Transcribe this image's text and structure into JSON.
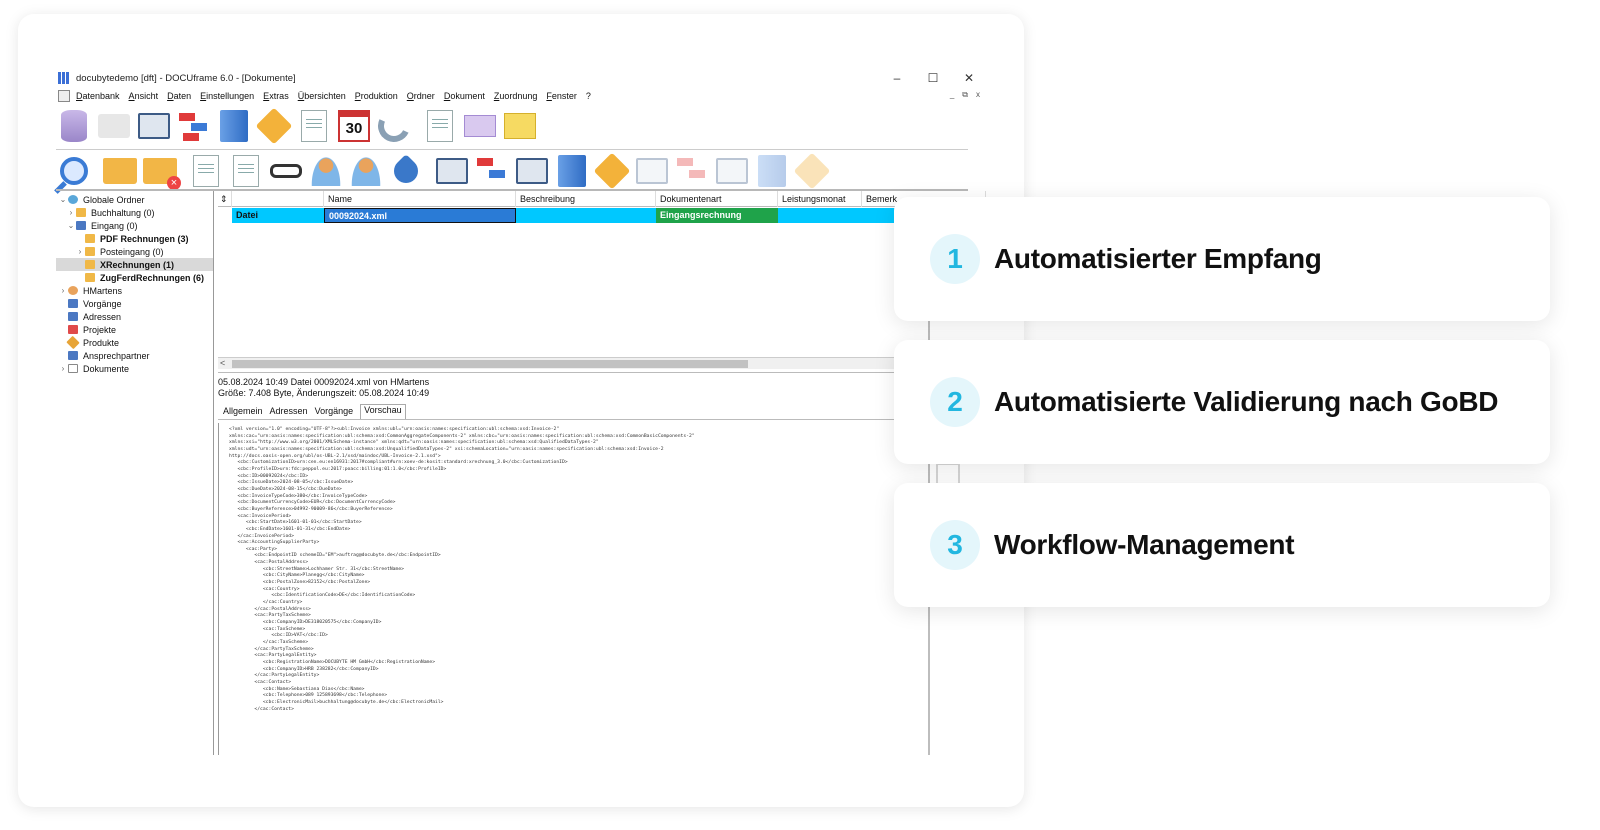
{
  "window": {
    "title": "docubytedemo [dft] - DOCUframe 6.0 - [Dokumente]",
    "controls": [
      "–",
      "☐",
      "✕"
    ],
    "mdi_controls": [
      "_",
      "⧉",
      "x"
    ]
  },
  "menu": [
    "Datenbank",
    "Ansicht",
    "Daten",
    "Einstellungen",
    "Extras",
    "Übersichten",
    "Produktion",
    "Ordner",
    "Dokument",
    "Zuordnung",
    "Fenster",
    "?"
  ],
  "toolbar_icons_row1": [
    "database-icon",
    "printer-icon",
    "contact-card-icon",
    "workflow-icon",
    "book-icon",
    "tag-icon",
    "document-icon",
    "calendar-icon",
    "phone-icon",
    "note-document-icon",
    "envelope-icon",
    "sticky-note-icon"
  ],
  "calendar_day": "30",
  "toolbar_icons_row2": [
    "search-icon",
    "folder-icon",
    "folder-delete-icon",
    "document-import-icon",
    "document-delete-icon",
    "glasses-icon",
    "person-icon",
    "person-group-icon",
    "pin-icon"
  ],
  "tree": {
    "items": [
      {
        "label": "Globale Ordner",
        "level": 0
      },
      {
        "label": "Buchhaltung (0)",
        "level": 1
      },
      {
        "label": "Eingang (0)",
        "level": 1
      },
      {
        "label": "PDF Rechnungen (3)",
        "level": 2
      },
      {
        "label": "Posteingang (0)",
        "level": 2
      },
      {
        "label": "XRechnungen (1)",
        "level": 2
      },
      {
        "label": "ZugFerdRechnungen (6)",
        "level": 2
      },
      {
        "label": "HMartens",
        "level": 0
      },
      {
        "label": "Vorgänge",
        "level": 0
      },
      {
        "label": "Adressen",
        "level": 0
      },
      {
        "label": "Projekte",
        "level": 0
      },
      {
        "label": "Produkte",
        "level": 0
      },
      {
        "label": "Ansprechpartner",
        "level": 0
      },
      {
        "label": "Dokumente",
        "level": 0
      }
    ]
  },
  "list": {
    "sort_icon": "⇕",
    "columns": [
      "",
      "Name",
      "Beschreibung",
      "Dokumentenart",
      "Leistungsmonat",
      "Bemerk"
    ],
    "row": {
      "type": "Datei",
      "name": "00092024.xml",
      "description": "",
      "kind": "Eingangsrechnung",
      "month": "",
      "note": ""
    },
    "scroll_left": "<"
  },
  "status": {
    "line1": "05.08.2024 10:49 Datei 00092024.xml von HMartens",
    "line2": "Größe: 7.408 Byte, Änderungszeit: 05.08.2024 10:49"
  },
  "tabs": [
    "Allgemein",
    "Adressen",
    "Vorgänge",
    "Vorschau"
  ],
  "xml_lines": [
    "<?xml version=\"1.0\" encoding=\"UTF-8\"?><ubl:Invoice xmlns:ubl=\"urn:oasis:names:specification:ubl:schema:xsd:Invoice-2\"",
    "xmlns:cac=\"urn:oasis:names:specification:ubl:schema:xsd:CommonAggregateComponents-2\" xmlns:cbc=\"urn:oasis:names:specification:ubl:schema:xsd:CommonBasicComponents-2\"",
    "xmlns:xsi=\"http://www.w3.org/2001/XMLSchema-instance\" xmlns:qdt=\"urn:oasis:names:specification:ubl:schema:xsd:QualifiedDataTypes-2\"",
    "xmlns:udt=\"urn:oasis:names:specification:ubl:schema:xsd:UnqualifiedDataTypes-2\" xsi:schemaLocation=\"urn:oasis:names:specification:ubl:schema:xsd:Invoice-2",
    "http://docs.oasis-open.org/ubl/os-UBL-2.1/xsd/maindoc/UBL-Invoice-2.1.xsd\">",
    "   <cbc:CustomizationID>urn:cen.eu:en16931:2017#compliant#urn:xoev-de:kosit:standard:xrechnung_3.0</cbc:CustomizationID>",
    "   <cbc:ProfileID>urn:fdc:peppol.eu:2017:poacc:billing:01:1.0</cbc:ProfileID>",
    "   <cbc:ID>00092024</cbc:ID>",
    "   <cbc:IssueDate>2024-08-05</cbc:IssueDate>",
    "   <cbc:DueDate>2024-08-15</cbc:DueDate>",
    "   <cbc:InvoiceTypeCode>380</cbc:InvoiceTypeCode>",
    "   <cbc:DocumentCurrencyCode>EUR</cbc:DocumentCurrencyCode>",
    "   <cbc:BuyerReference>04992-90009-86</cbc:BuyerReference>",
    "   <cac:InvoicePeriod>",
    "      <cbc:StartDate>1601-01-01</cbc:StartDate>",
    "      <cbc:EndDate>1601-01-31</cbc:EndDate>",
    "   </cac:InvoicePeriod>",
    "   <cac:AccountingSupplierParty>",
    "      <cac:Party>",
    "         <cbc:EndpointID schemeID=\"EM\">auftrag@docubyte.de</cbc:EndpointID>",
    "         <cac:PostalAddress>",
    "            <cbc:StreetName>Lochhamer Str. 31</cbc:StreetName>",
    "            <cbc:CityName>Planegg</cbc:CityName>",
    "            <cbc:PostalZone>82152</cbc:PostalZone>",
    "            <cac:Country>",
    "               <cbc:IdentificationCode>DE</cbc:IdentificationCode>",
    "            </cac:Country>",
    "         </cac:PostalAddress>",
    "         <cac:PartyTaxScheme>",
    "            <cbc:CompanyID>DE318020575</cbc:CompanyID>",
    "            <cac:TaxScheme>",
    "               <cbc:ID>VAT</cbc:ID>",
    "            </cac:TaxScheme>",
    "         </cac:PartyTaxScheme>",
    "         <cac:PartyLegalEntity>",
    "            <cbc:RegistrationName>DOCUBYTE HM GmbH</cbc:RegistrationName>",
    "            <cbc:CompanyID>HRB 238282</cbc:CompanyID>",
    "         </cac:PartyLegalEntity>",
    "         <cac:Contact>",
    "            <cbc:Name>Sebastiana Dias</cbc:Name>",
    "            <cbc:Telephone>089 125893698</cbc:Telephone>",
    "            <cbc:ElectronicMail>buchhaltung@docubyte.de</cbc:ElectronicMail>",
    "         </cac:Contact>"
  ],
  "features": [
    {
      "number": "1",
      "label": "Automatisierter Empfang"
    },
    {
      "number": "2",
      "label": "Automatisierte Validierung nach GoBD"
    },
    {
      "number": "3",
      "label": "Workflow-Management"
    }
  ],
  "colors": {
    "accent": "#22b7e0",
    "accent_bg": "#e4f6fb",
    "selection": "#00c8ff",
    "kind_badge": "#1fa34a"
  }
}
